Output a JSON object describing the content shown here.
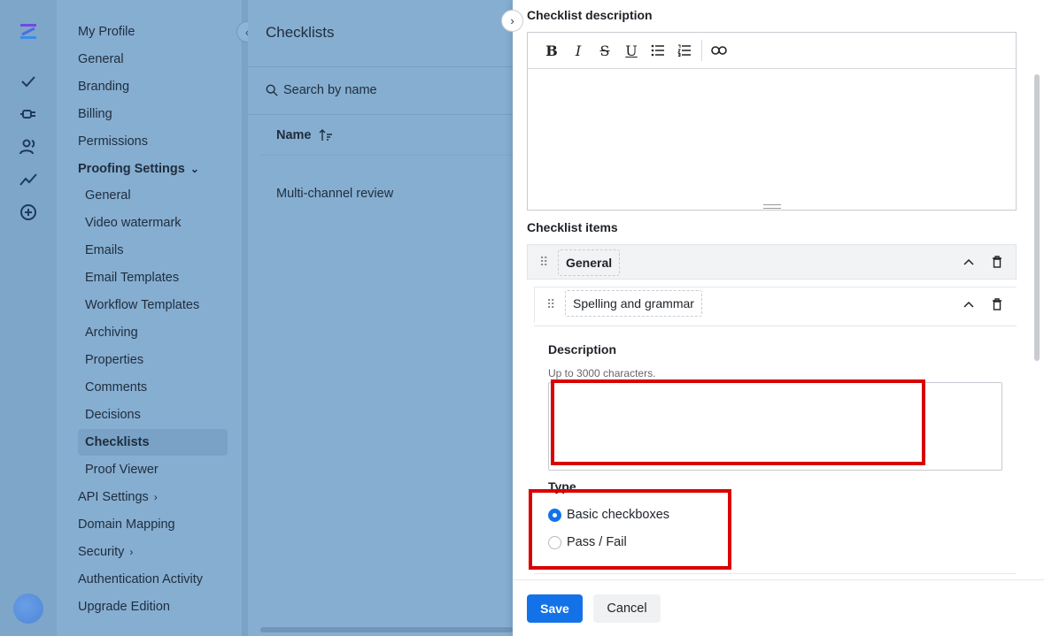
{
  "sidebar": {
    "items": [
      {
        "label": "My Profile"
      },
      {
        "label": "General"
      },
      {
        "label": "Branding"
      },
      {
        "label": "Billing"
      },
      {
        "label": "Permissions"
      },
      {
        "label": "Proofing Settings"
      },
      {
        "label": "General"
      },
      {
        "label": "Video watermark"
      },
      {
        "label": "Emails"
      },
      {
        "label": "Email Templates"
      },
      {
        "label": "Workflow Templates"
      },
      {
        "label": "Archiving"
      },
      {
        "label": "Properties"
      },
      {
        "label": "Comments"
      },
      {
        "label": "Decisions"
      },
      {
        "label": "Checklists"
      },
      {
        "label": "Proof Viewer"
      },
      {
        "label": "API Settings"
      },
      {
        "label": "Domain Mapping"
      },
      {
        "label": "Security"
      },
      {
        "label": "Authentication Activity"
      },
      {
        "label": "Upgrade Edition"
      }
    ]
  },
  "main": {
    "title": "Checklists",
    "search_placeholder": "Search by name",
    "column_name": "Name",
    "rows": [
      "Multi-channel review"
    ]
  },
  "drawer": {
    "checklist_description_label": "Checklist description",
    "checklist_items_label": "Checklist items",
    "group_name": "General",
    "item_name": "Spelling and grammar",
    "description_label": "Description",
    "description_hint": "Up to 3000 characters.",
    "description_value": "",
    "type_label": "Type",
    "type_options": [
      "Basic checkboxes",
      "Pass / Fail"
    ],
    "type_selected": "Basic checkboxes",
    "save_label": "Save",
    "cancel_label": "Cancel"
  },
  "colors": {
    "accent": "#1472e8",
    "highlight": "#d90000"
  }
}
